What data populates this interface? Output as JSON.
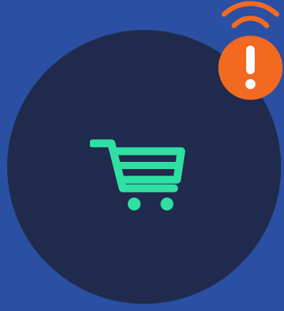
{
  "app_tile": {
    "icon": "shopping-cart-icon",
    "background_color": "#1f2a4c",
    "icon_color": "#2fe0a2"
  },
  "status_badge": {
    "icon": "alert-exclamation-icon",
    "background_color": "#f26a21",
    "symbol_color": "#ffffff"
  },
  "connectivity": {
    "icon": "wifi-signal-icon",
    "color": "#f26a21"
  },
  "background_color": "#2a4fa3"
}
